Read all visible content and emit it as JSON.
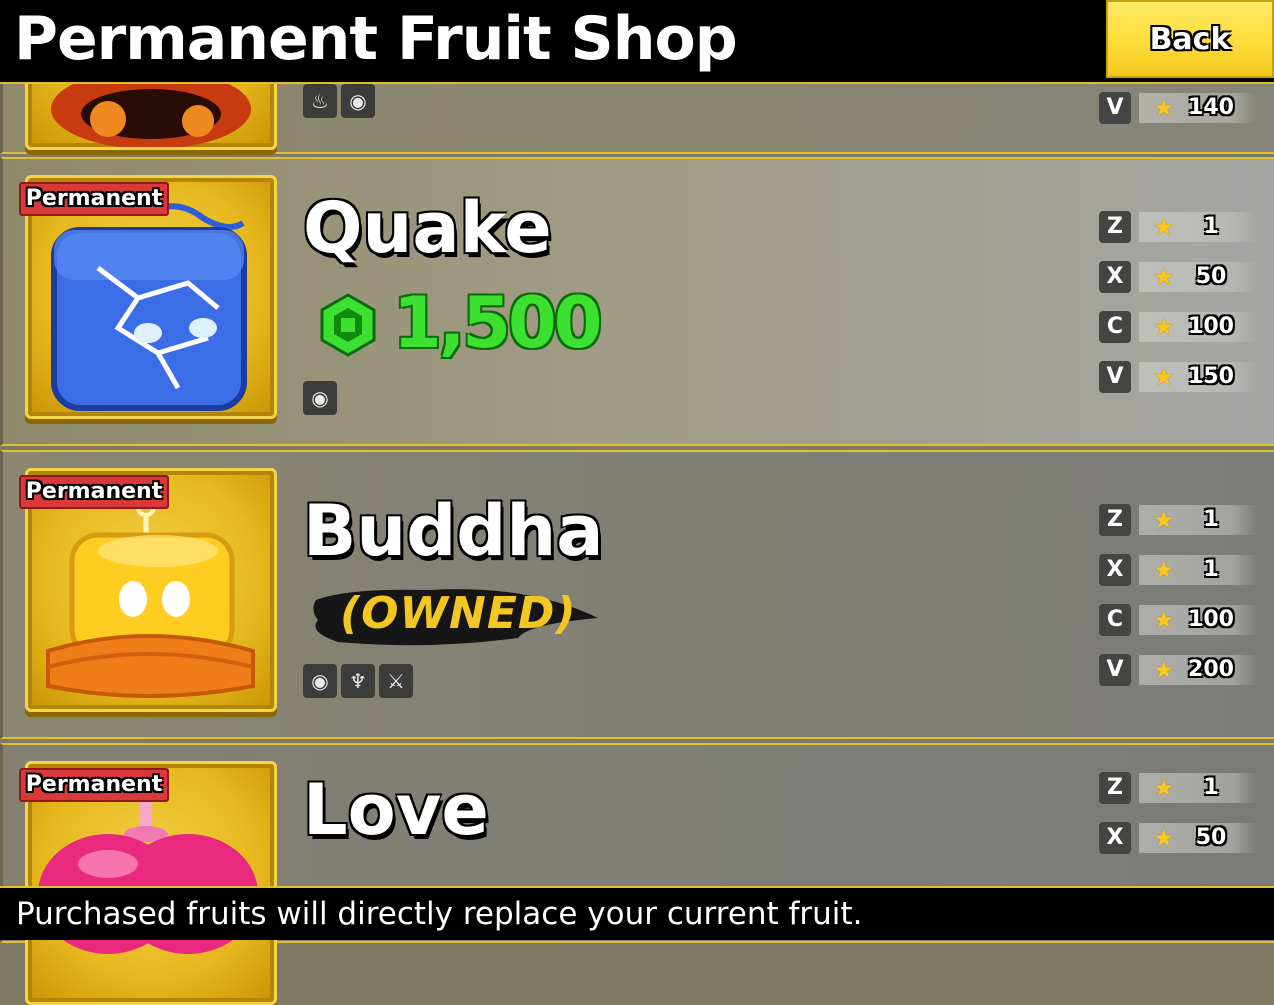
{
  "header": {
    "title": "Permanent Fruit Shop",
    "back_label": "Back"
  },
  "rows": [
    {
      "name": "",
      "tags": [
        "fire-icon",
        "eye-icon"
      ],
      "abilities": [
        {
          "key": "V",
          "level": "140"
        }
      ]
    },
    {
      "name": "Quake",
      "badge": "Permanent",
      "price": "1,500",
      "tags": [
        "eye-icon"
      ],
      "abilities": [
        {
          "key": "Z",
          "level": "1"
        },
        {
          "key": "X",
          "level": "50"
        },
        {
          "key": "C",
          "level": "100"
        },
        {
          "key": "V",
          "level": "150"
        }
      ]
    },
    {
      "name": "Buddha",
      "badge": "Permanent",
      "status": "(OWNED)",
      "tags": [
        "eye-icon",
        "dragon-icon",
        "sword-icon"
      ],
      "abilities": [
        {
          "key": "Z",
          "level": "1"
        },
        {
          "key": "X",
          "level": "1"
        },
        {
          "key": "C",
          "level": "100"
        },
        {
          "key": "V",
          "level": "200"
        }
      ]
    },
    {
      "name": "Love",
      "badge": "Permanent",
      "abilities": [
        {
          "key": "Z",
          "level": "1"
        },
        {
          "key": "X",
          "level": "50"
        }
      ]
    }
  ],
  "footer": {
    "text": "Purchased fruits will directly replace your current fruit."
  },
  "colors": {
    "accent": "#e0c030",
    "price_green": "#3ce030",
    "badge_red": "#d9393b",
    "owned_yellow": "#f3c624"
  }
}
